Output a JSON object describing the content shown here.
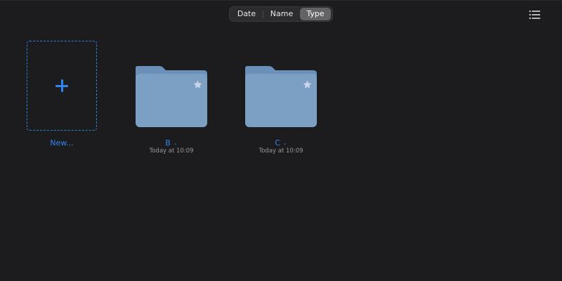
{
  "toolbar": {
    "sort_options": [
      {
        "label": "Date",
        "selected": false
      },
      {
        "label": "Name",
        "selected": false
      },
      {
        "label": "Type",
        "selected": true
      }
    ],
    "view_toggle_icon": "list-icon"
  },
  "new_item": {
    "label": "New...",
    "icon": "plus-icon"
  },
  "folders": [
    {
      "name": "B",
      "date": "Today at 10:09",
      "favorite_icon": "star-icon"
    },
    {
      "name": "C",
      "date": "Today at 10:09",
      "favorite_icon": "star-icon"
    }
  ],
  "colors": {
    "background": "#1c1c1e",
    "accent": "#2f86f0",
    "folder_body": "#7c9fc4",
    "folder_tab": "#6a8fb8",
    "secondary_text": "#98989d",
    "segment_selected": "#636366"
  }
}
